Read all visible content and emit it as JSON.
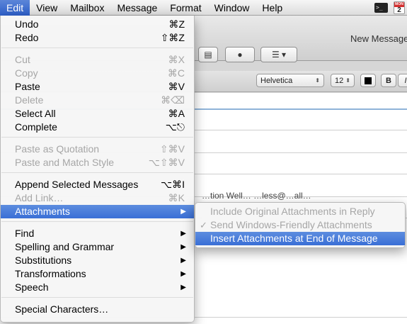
{
  "menubar": {
    "items": [
      "Edit",
      "View",
      "Mailbox",
      "Message",
      "Format",
      "Window",
      "Help"
    ],
    "status": {
      "calendar_month": "MON",
      "calendar_day": "2"
    }
  },
  "window": {
    "title": "New Message",
    "format_bar": {
      "font": "Helvetica",
      "size": "12",
      "bold": "B",
      "italic": "I"
    },
    "partial_text": "…tion Well…  …less@…all…"
  },
  "edit_menu": {
    "undo": {
      "label": "Undo",
      "shortcut": "⌘Z"
    },
    "redo": {
      "label": "Redo",
      "shortcut": "⇧⌘Z"
    },
    "cut": {
      "label": "Cut",
      "shortcut": "⌘X"
    },
    "copy": {
      "label": "Copy",
      "shortcut": "⌘C"
    },
    "paste": {
      "label": "Paste",
      "shortcut": "⌘V"
    },
    "delete": {
      "label": "Delete",
      "shortcut": "⌘⌫"
    },
    "select_all": {
      "label": "Select All",
      "shortcut": "⌘A"
    },
    "complete": {
      "label": "Complete",
      "shortcut": "⌥⎋"
    },
    "paste_quotation": {
      "label": "Paste as Quotation",
      "shortcut": "⇧⌘V"
    },
    "paste_match_style": {
      "label": "Paste and Match Style",
      "shortcut": "⌥⇧⌘V"
    },
    "append_selected": {
      "label": "Append Selected Messages",
      "shortcut": "⌥⌘I"
    },
    "add_link": {
      "label": "Add Link…",
      "shortcut": "⌘K"
    },
    "attachments": {
      "label": "Attachments"
    },
    "find": {
      "label": "Find"
    },
    "spelling": {
      "label": "Spelling and Grammar"
    },
    "substitutions": {
      "label": "Substitutions"
    },
    "transformations": {
      "label": "Transformations"
    },
    "speech": {
      "label": "Speech"
    },
    "special_chars": {
      "label": "Special Characters…"
    }
  },
  "attachments_submenu": {
    "include_original": "Include Original Attachments in Reply",
    "send_windows_friendly": "Send Windows-Friendly Attachments",
    "insert_at_end": "Insert Attachments at End of Message"
  },
  "colors": {
    "highlight": "#3a6fd6",
    "disabled": "#a6a6a6"
  }
}
